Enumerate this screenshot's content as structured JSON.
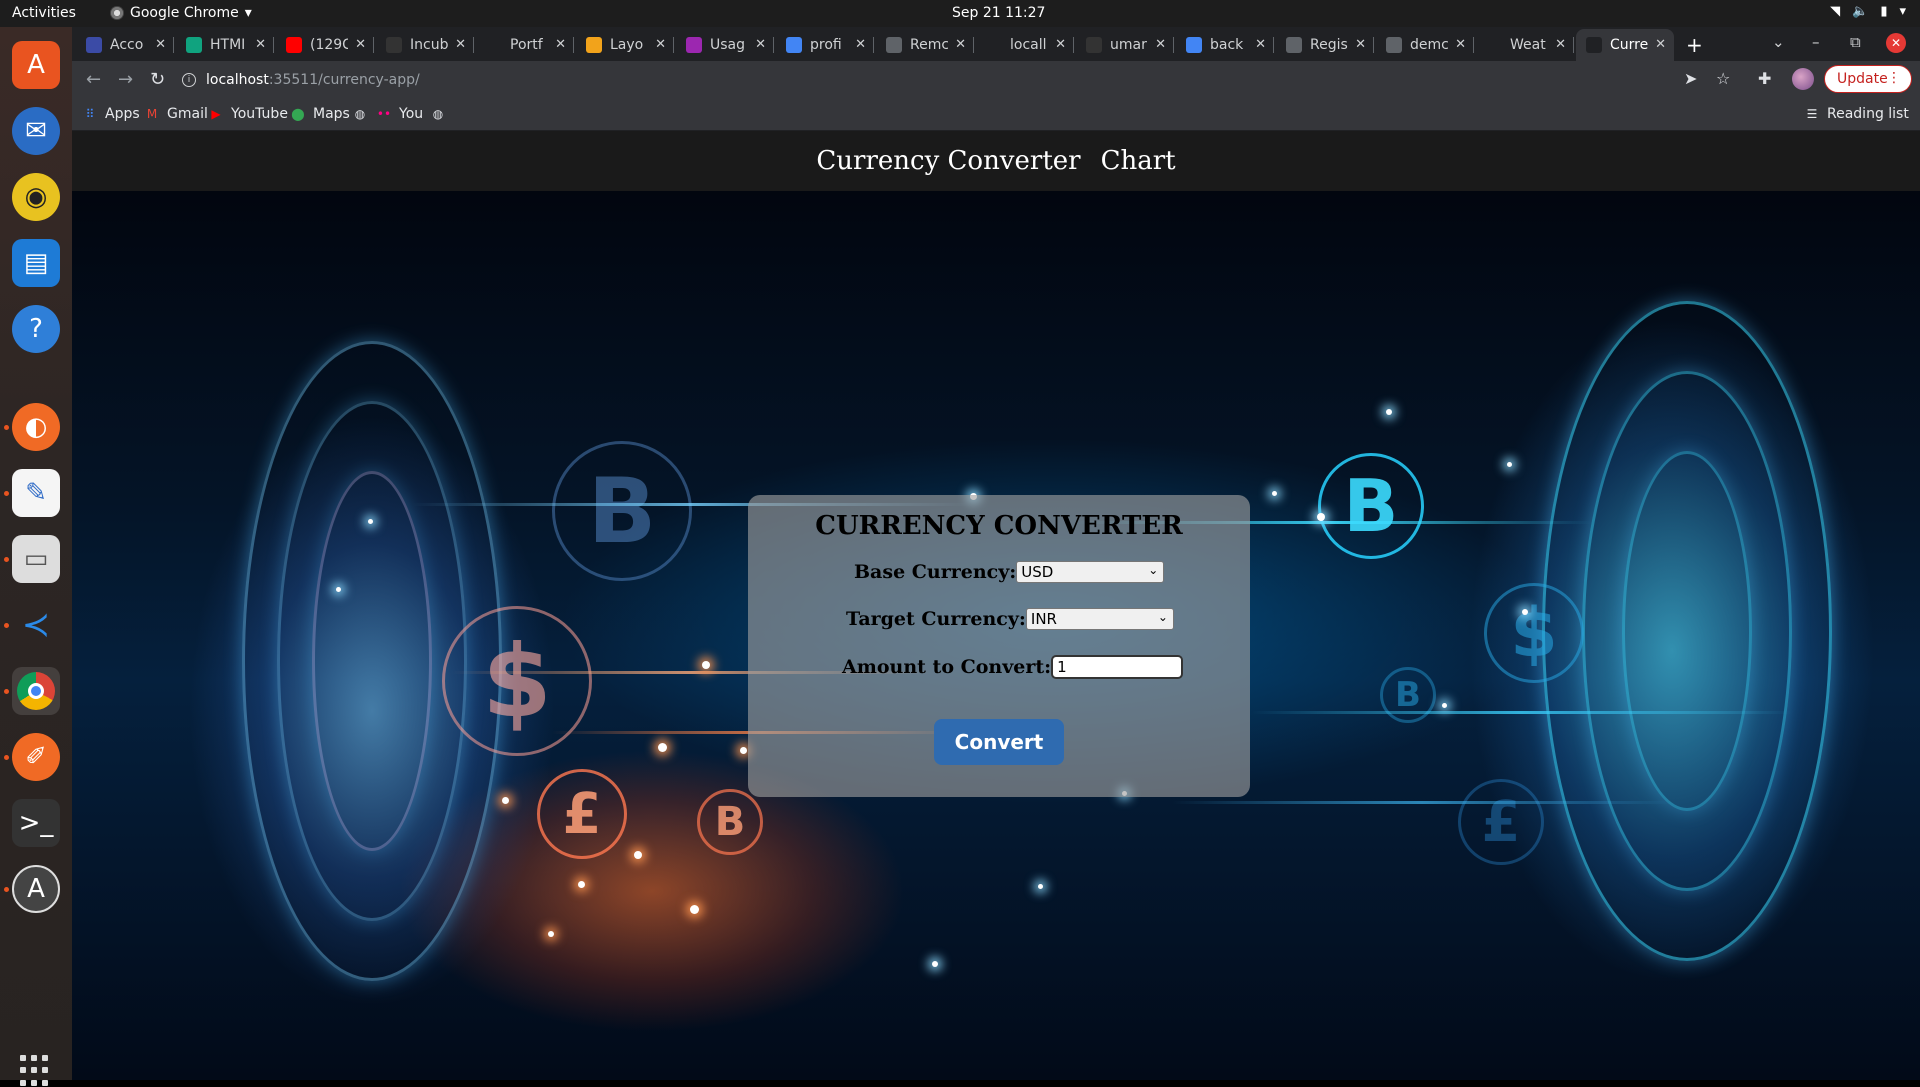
{
  "os": {
    "activities": "Activities",
    "app_name": "Google Chrome",
    "clock": "Sep 21  11:27"
  },
  "browser": {
    "tabs": [
      {
        "title": "Acco",
        "icon": "angular-icon",
        "color": "#3b4ba6"
      },
      {
        "title": "HTMI",
        "icon": "openai-icon",
        "color": "#10a37f"
      },
      {
        "title": "(129C",
        "icon": "youtube-icon",
        "color": "#ff0000"
      },
      {
        "title": "Incub",
        "icon": "github-icon",
        "color": "#333333"
      },
      {
        "title": "Portf",
        "icon": "angular-a-icon",
        "color": "#202124"
      },
      {
        "title": "Layo",
        "icon": "shield-icon",
        "color": "#f2a31b"
      },
      {
        "title": "Usag",
        "icon": "cube-icon",
        "color": "#9c27b0"
      },
      {
        "title": "profi",
        "icon": "google-icon",
        "color": "#4285f4"
      },
      {
        "title": "Remc",
        "icon": "stack-icon",
        "color": "#5f6368"
      },
      {
        "title": "locall",
        "icon": "angular-a-icon",
        "color": "#202124"
      },
      {
        "title": "umar",
        "icon": "github-icon",
        "color": "#333333"
      },
      {
        "title": "back",
        "icon": "google-icon",
        "color": "#4285f4"
      },
      {
        "title": "Regis",
        "icon": "form-icon",
        "color": "#5f6368"
      },
      {
        "title": "demc",
        "icon": "globe-icon",
        "color": "#5f6368"
      },
      {
        "title": "Weat",
        "icon": "angular-a-icon",
        "color": "#202124"
      },
      {
        "title": "Curre",
        "icon": "angular-a-icon",
        "color": "#202124",
        "active": true
      }
    ],
    "url_host": "localhost",
    "url_rest": ":35511/currency-app/",
    "update_label": "Update",
    "bookmarks": [
      {
        "label": "Apps",
        "icon": "apps-grid-icon"
      },
      {
        "label": "Gmail",
        "icon": "gmail-icon"
      },
      {
        "label": "YouTube",
        "icon": "youtube-icon"
      },
      {
        "label": "Maps",
        "icon": "maps-pin-icon"
      },
      {
        "label": "",
        "icon": "globe-icon"
      },
      {
        "label": "You",
        "icon": "flickr-icon"
      },
      {
        "label": "",
        "icon": "globe-icon"
      }
    ],
    "reading_list": "Reading list"
  },
  "page": {
    "nav": {
      "converter_link": "Currency Converter",
      "chart_link": "Chart"
    },
    "card": {
      "title": "CURRENCY CONVERTER",
      "base_label": "Base Currency:",
      "base_value": "USD",
      "target_label": "Target Currency:",
      "target_value": "INR",
      "amount_label": "Amount to Convert:",
      "amount_value": "1",
      "convert_label": "Convert"
    }
  }
}
